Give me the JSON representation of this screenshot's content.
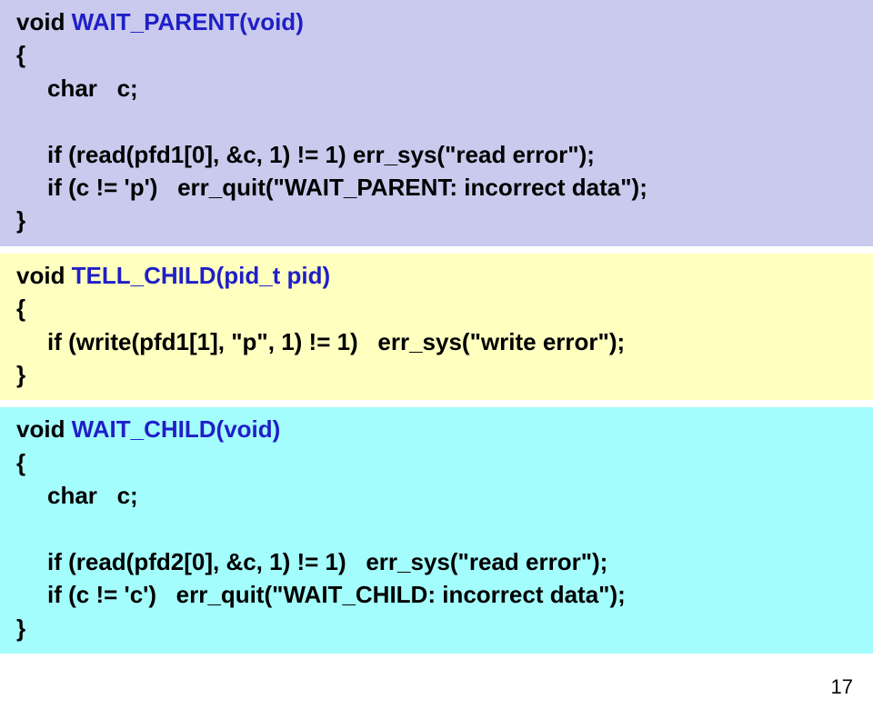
{
  "block1": {
    "l1_void": "void ",
    "l1_fn": "WAIT_PARENT(void)",
    "l2": "{",
    "l3": "char   c;",
    "l4": "if (read(pfd1[0], &c, 1) != 1) err_sys(\"read error\");",
    "l5": "if (c != 'p')   err_quit(\"WAIT_PARENT: incorrect data\");",
    "l6": "}"
  },
  "block2": {
    "l1_void": "void ",
    "l1_fn": "TELL_CHILD(pid_t pid)",
    "l2": "{",
    "l3": "if (write(pfd1[1], \"p\", 1) != 1)   err_sys(\"write error\");",
    "l4": "}"
  },
  "block3": {
    "l1_void": "void ",
    "l1_fn": "WAIT_CHILD(void)",
    "l2": "{",
    "l3": "char   c;",
    "l4": "if (read(pfd2[0], &c, 1) != 1)   err_sys(\"read error\");",
    "l5": "if (c != 'c')   err_quit(\"WAIT_CHILD: incorrect data\");",
    "l6": "}"
  },
  "page_number": "17"
}
